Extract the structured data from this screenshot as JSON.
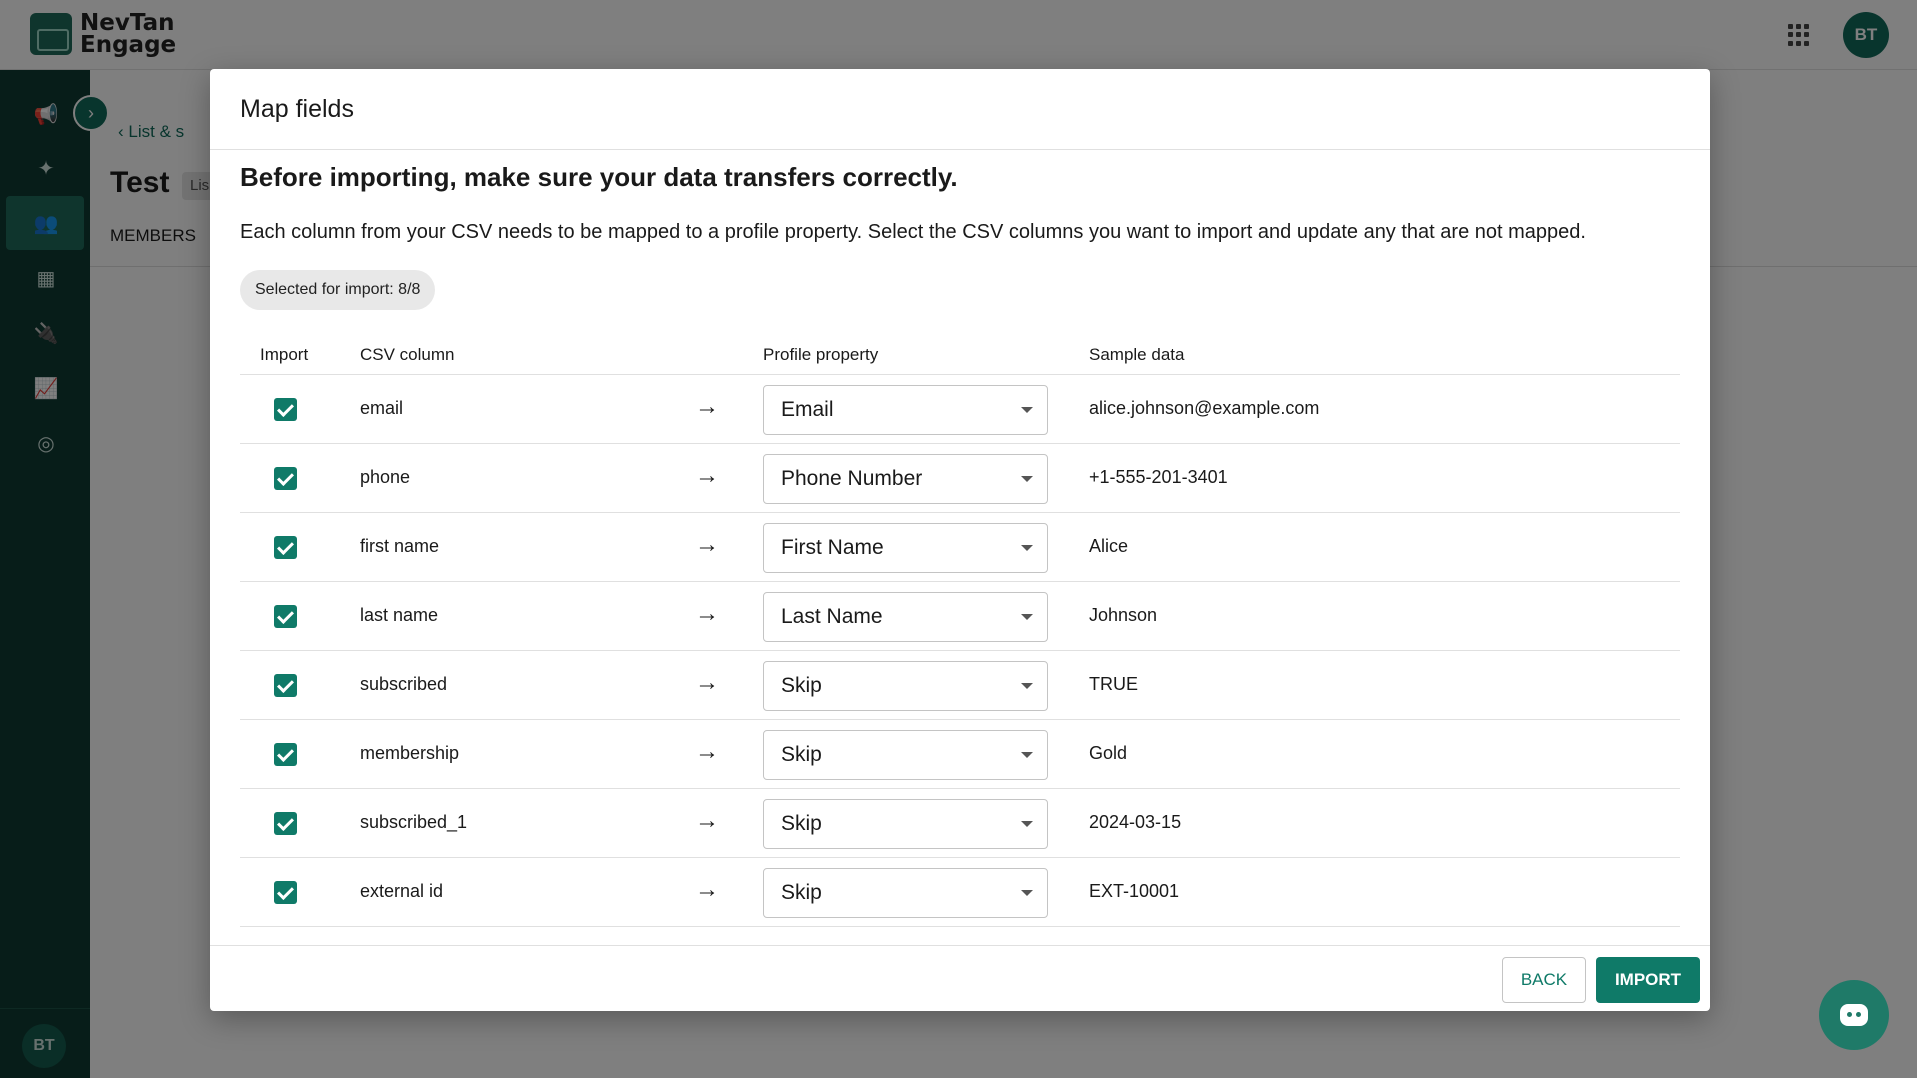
{
  "app": {
    "brand": "NevTan Engage",
    "brand_line1": "NevTan",
    "brand_line2": "Engage",
    "user_initials": "BT",
    "accent_color": "#0f7a68",
    "sidebar_color": "#0f3b33"
  },
  "sidebar": {
    "items": [
      {
        "icon": "megaphone-icon",
        "glyph": "📢"
      },
      {
        "icon": "sparkle-icon",
        "glyph": "✦"
      },
      {
        "icon": "contacts-icon",
        "glyph": "👥"
      },
      {
        "icon": "apps-grid-icon",
        "glyph": "▦"
      },
      {
        "icon": "plug-icon",
        "glyph": "🔌"
      },
      {
        "icon": "trend-chart-icon",
        "glyph": "📈"
      },
      {
        "icon": "account-circle-icon",
        "glyph": "◎"
      }
    ],
    "collapse_glyph": "›",
    "user_initials": "BT"
  },
  "background_page": {
    "breadcrumb": "List & s",
    "title": "Test",
    "chip": "Lis",
    "tab": "MEMBERS"
  },
  "dialog": {
    "title": "Map fields",
    "heading": "Before importing, make sure your data transfers correctly.",
    "description": "Each column from your CSV needs to be mapped to a profile property. Select the CSV columns you want to import and update any that are not mapped.",
    "selected_label": "Selected for import: 8/8",
    "columns": {
      "import": "Import",
      "csv_column": "CSV column",
      "profile_property": "Profile property",
      "sample_data": "Sample data"
    },
    "rows": [
      {
        "checked": true,
        "csv": "email",
        "property": "Email",
        "sample": "alice.johnson@example.com"
      },
      {
        "checked": true,
        "csv": "phone",
        "property": "Phone Number",
        "sample": "+1-555-201-3401"
      },
      {
        "checked": true,
        "csv": "first name",
        "property": "First Name",
        "sample": "Alice"
      },
      {
        "checked": true,
        "csv": "last name",
        "property": "Last Name",
        "sample": "Johnson"
      },
      {
        "checked": true,
        "csv": "subscribed",
        "property": "Skip",
        "sample": "TRUE"
      },
      {
        "checked": true,
        "csv": "membership",
        "property": "Skip",
        "sample": "Gold"
      },
      {
        "checked": true,
        "csv": "subscribed_1",
        "property": "Skip",
        "sample": "2024-03-15"
      },
      {
        "checked": true,
        "csv": "external id",
        "property": "Skip",
        "sample": "EXT-10001"
      }
    ],
    "back_label": "BACK",
    "import_label": "IMPORT"
  }
}
